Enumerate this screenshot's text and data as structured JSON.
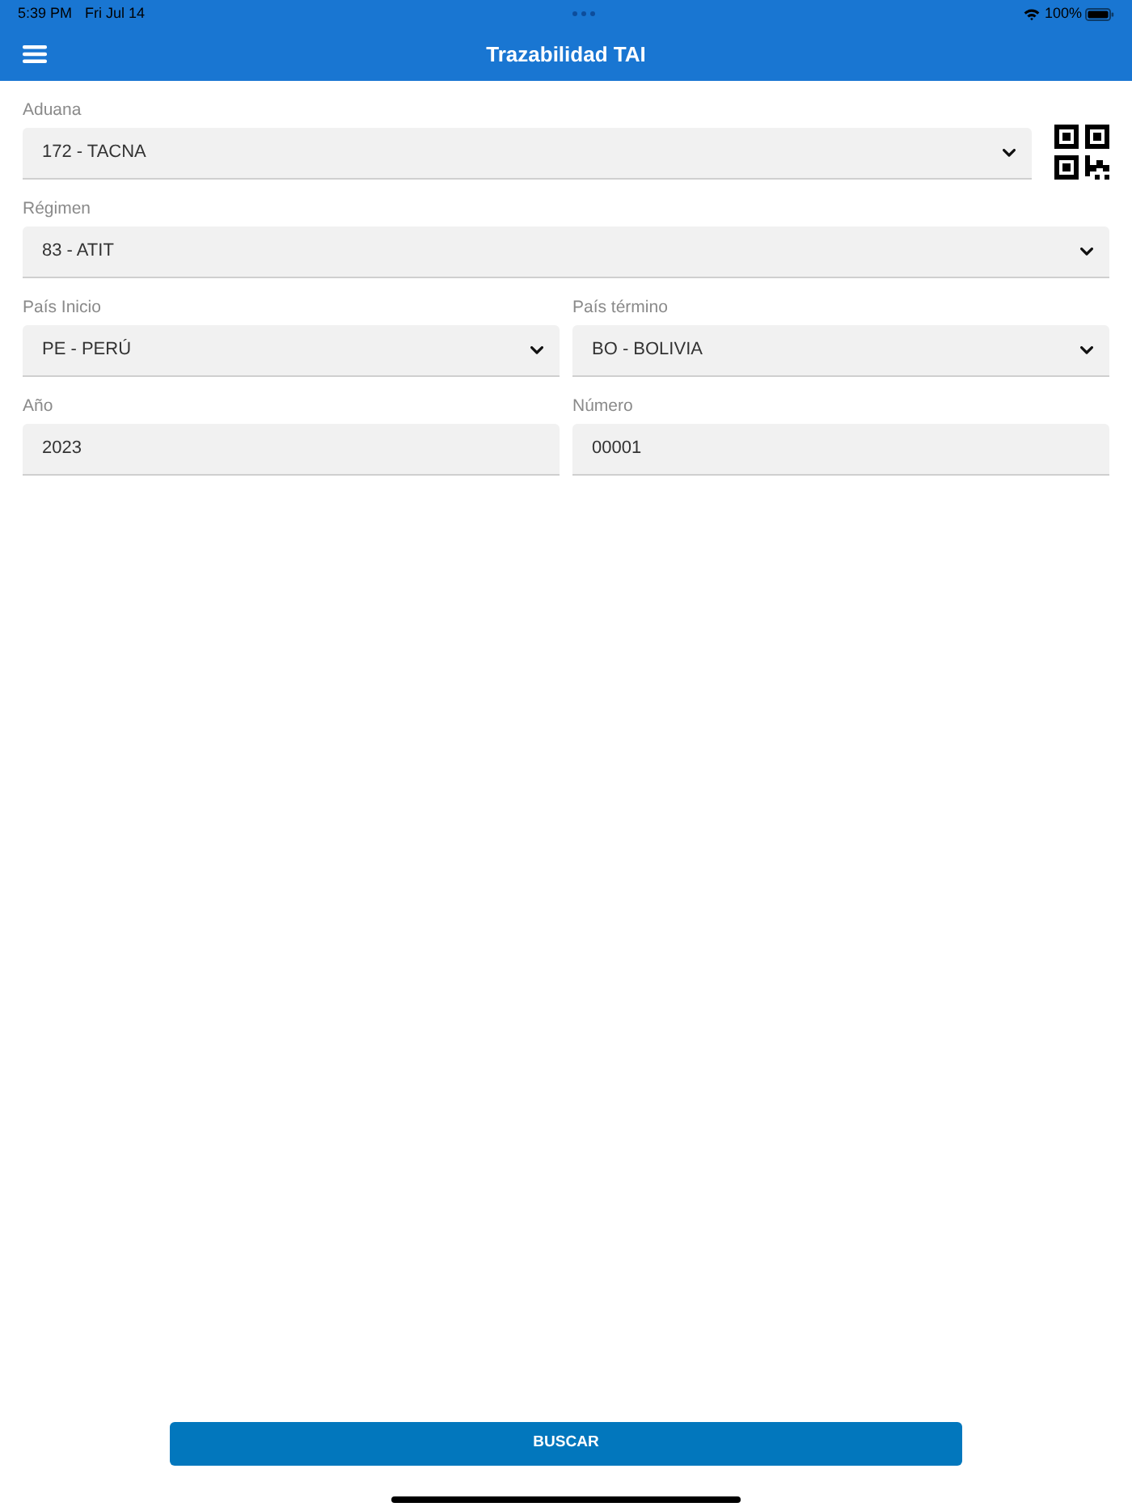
{
  "status_bar": {
    "time": "5:39 PM",
    "date": "Fri Jul 14",
    "battery": "100%"
  },
  "app_bar": {
    "title": "Trazabilidad TAI"
  },
  "rows": [
    {
      "scan_button": true,
      "fields": [
        {
          "kind": "select",
          "label": "Aduana",
          "value": "172 - TACNA"
        }
      ]
    },
    {
      "scan_button": false,
      "fields": [
        {
          "kind": "select",
          "label": "Régimen",
          "value": "83 - ATIT"
        }
      ]
    },
    {
      "scan_button": false,
      "fields": [
        {
          "kind": "select",
          "label": "País Inicio",
          "value": "PE - PERÚ"
        },
        {
          "kind": "select",
          "label": "País término",
          "value": "BO - BOLIVIA"
        }
      ]
    },
    {
      "scan_button": false,
      "fields": [
        {
          "kind": "input",
          "label": "Año",
          "value": "2023"
        },
        {
          "kind": "input",
          "label": "Número",
          "value": "00001"
        }
      ]
    }
  ],
  "search_button": {
    "label": "BUSCAR"
  }
}
